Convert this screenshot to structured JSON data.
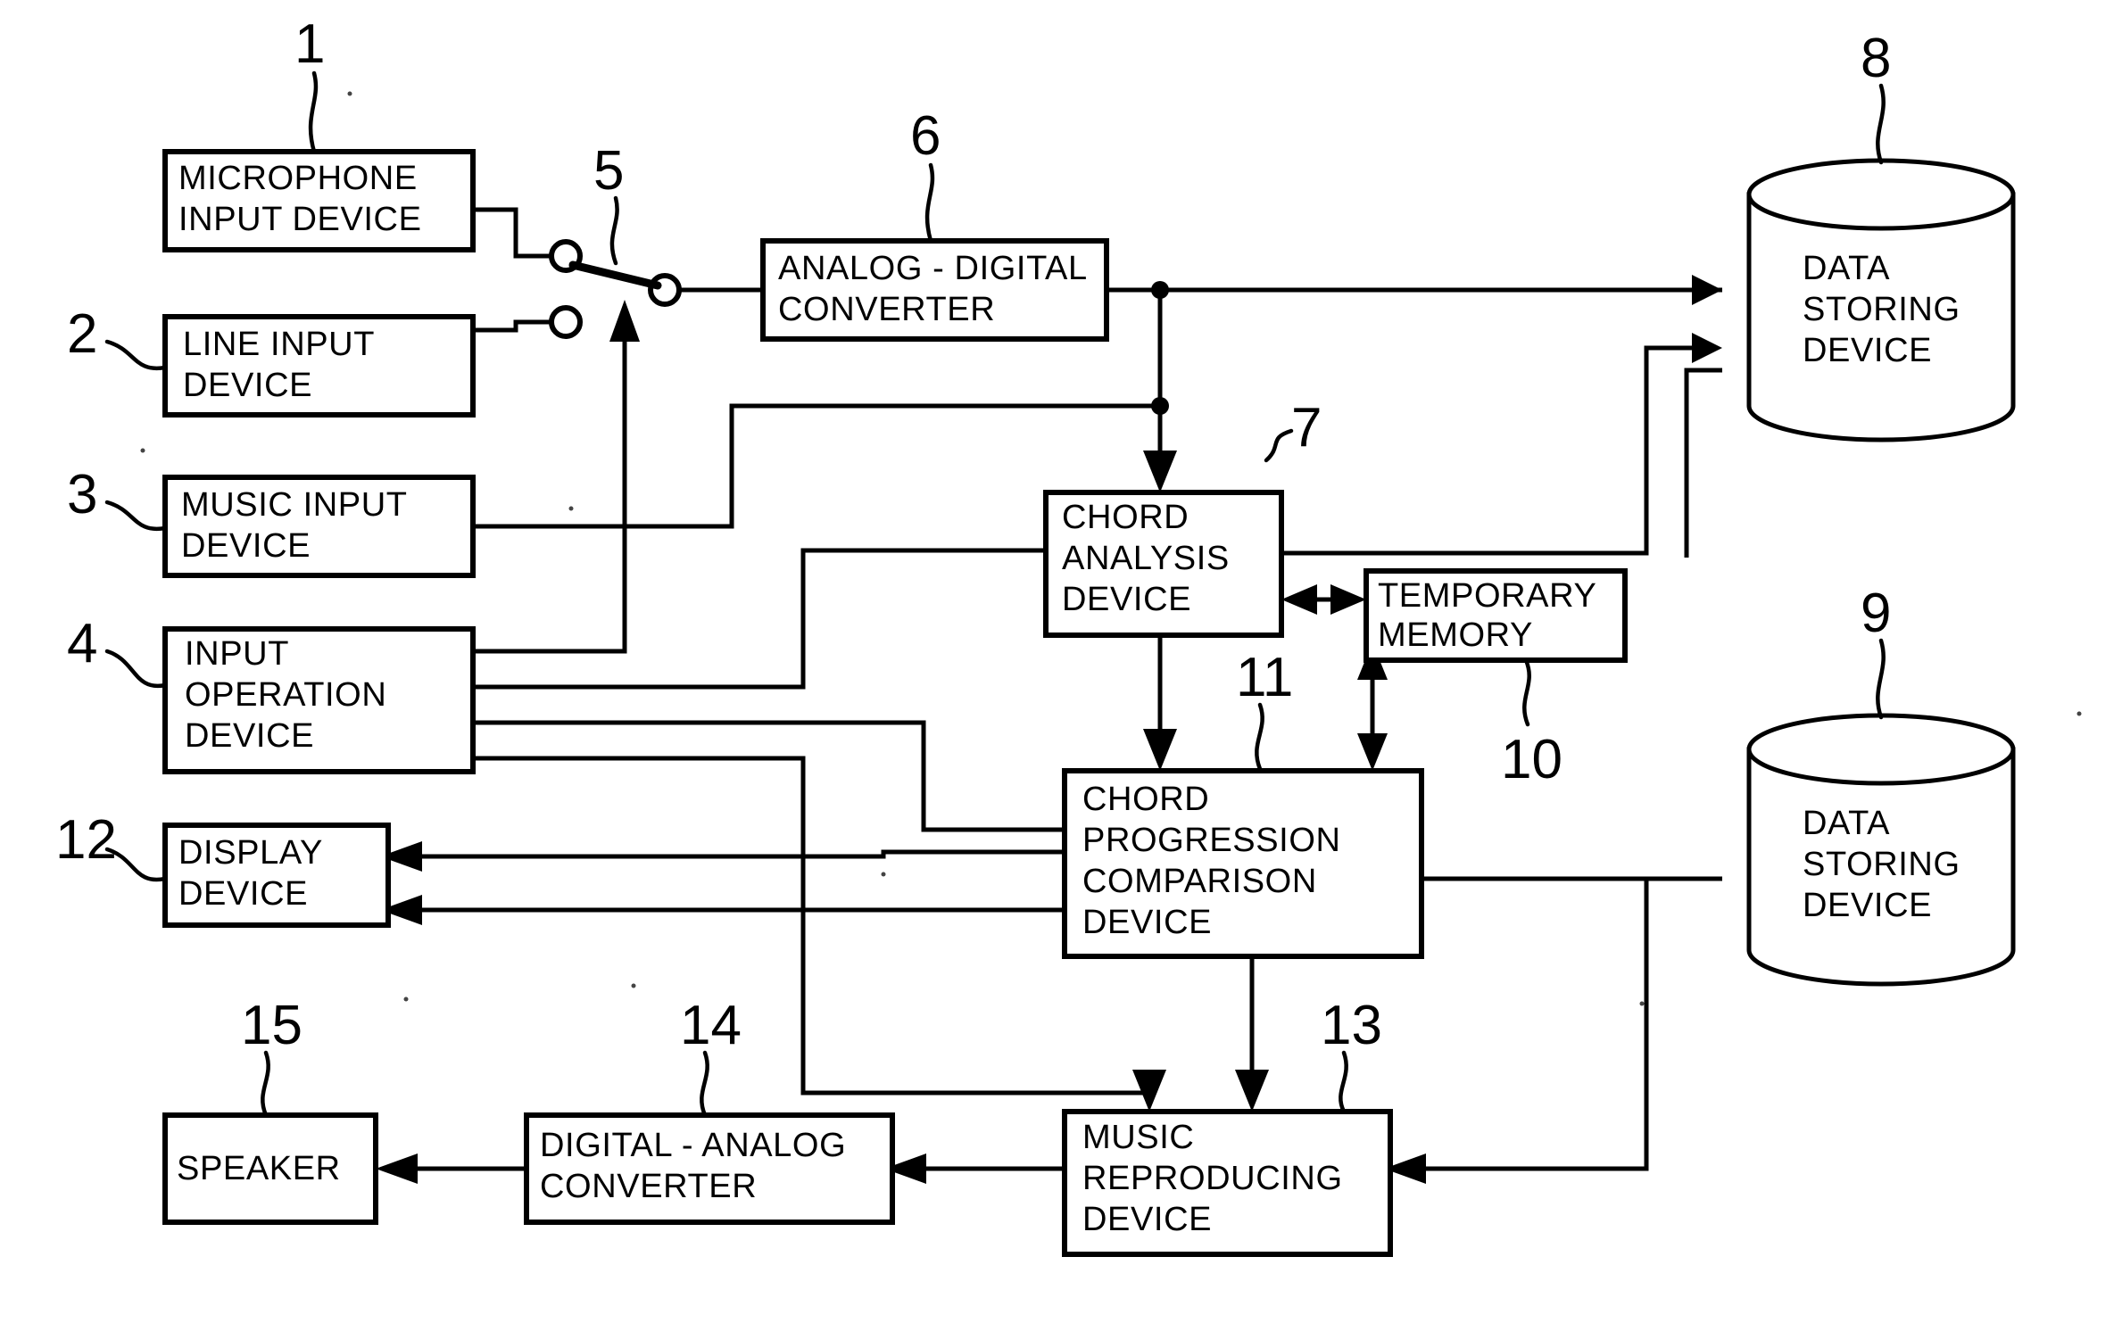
{
  "diagram": {
    "type": "block-diagram",
    "title": "Chord analysis and music reproduction system block diagram",
    "background_color": "#ffffff",
    "line_color": "#000000",
    "blocks": [
      {
        "ref": "1",
        "name": "microphone-input-device",
        "lines": [
          "MICROPHONE",
          "INPUT  DEVICE"
        ],
        "shape": "rect"
      },
      {
        "ref": "2",
        "name": "line-input-device",
        "lines": [
          "LINE  INPUT",
          "DEVICE"
        ],
        "shape": "rect"
      },
      {
        "ref": "3",
        "name": "music-input-device",
        "lines": [
          "MUSIC  INPUT",
          "DEVICE"
        ],
        "shape": "rect"
      },
      {
        "ref": "4",
        "name": "input-operation-device",
        "lines": [
          "INPUT",
          "OPERATION",
          "DEVICE"
        ],
        "shape": "rect"
      },
      {
        "ref": "5",
        "name": "input-selector-switch",
        "lines": [],
        "shape": "switch"
      },
      {
        "ref": "6",
        "name": "analog-digital-converter",
        "lines": [
          "ANALOG - DIGITAL",
          "CONVERTER"
        ],
        "shape": "rect"
      },
      {
        "ref": "7",
        "name": "chord-analysis-device",
        "lines": [
          "CHORD",
          "ANALYSIS",
          "DEVICE"
        ],
        "shape": "rect"
      },
      {
        "ref": "8",
        "name": "data-storing-device-upper",
        "lines": [
          "DATA",
          "STORING",
          "DEVICE"
        ],
        "shape": "cylinder"
      },
      {
        "ref": "9",
        "name": "data-storing-device-lower",
        "lines": [
          "DATA",
          "STORING",
          "DEVICE"
        ],
        "shape": "cylinder"
      },
      {
        "ref": "10",
        "name": "temporary-memory",
        "lines": [
          "TEMPORARY",
          "MEMORY"
        ],
        "shape": "rect"
      },
      {
        "ref": "11",
        "name": "chord-progression-comparison-device",
        "lines": [
          "CHORD",
          "PROGRESSION",
          "COMPARISON",
          "DEVICE"
        ],
        "shape": "rect"
      },
      {
        "ref": "12",
        "name": "display-device",
        "lines": [
          "DISPLAY",
          "DEVICE"
        ],
        "shape": "rect"
      },
      {
        "ref": "13",
        "name": "music-reproducing-device",
        "lines": [
          "MUSIC",
          "REPRODUCING",
          "DEVICE"
        ],
        "shape": "rect"
      },
      {
        "ref": "14",
        "name": "digital-analog-converter",
        "lines": [
          "DIGITAL - ANALOG",
          "CONVERTER"
        ],
        "shape": "rect"
      },
      {
        "ref": "15",
        "name": "speaker",
        "lines": [
          "SPEAKER"
        ],
        "shape": "rect"
      }
    ],
    "reference_numerals": [
      "1",
      "2",
      "3",
      "4",
      "5",
      "6",
      "7",
      "8",
      "9",
      "10",
      "11",
      "12",
      "13",
      "14",
      "15"
    ]
  }
}
